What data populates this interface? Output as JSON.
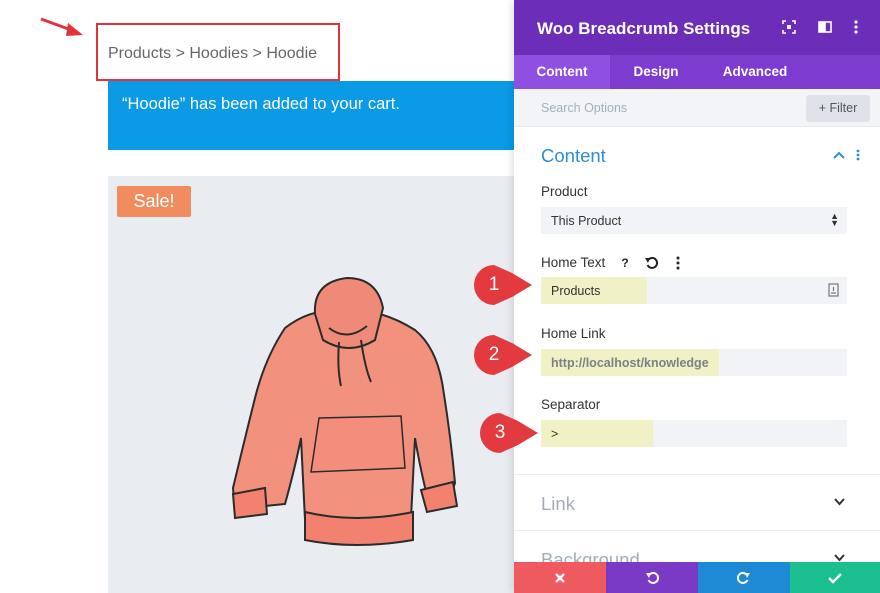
{
  "preview": {
    "breadcrumb": "Products > Hoodies > Hoodie",
    "notice": "“Hoodie” has been added to your cart.",
    "sale_badge": "Sale!"
  },
  "panel": {
    "title": "Woo Breadcrumb Settings",
    "header_icons": [
      "focus-icon",
      "columns-icon",
      "more-vertical-icon"
    ],
    "tabs": [
      {
        "label": "Content",
        "active": true
      },
      {
        "label": "Design",
        "active": false
      },
      {
        "label": "Advanced",
        "active": false
      }
    ],
    "search_placeholder": "Search Options",
    "filter_label": "+ Filter",
    "section_title": "Content",
    "product": {
      "label": "Product",
      "value": "This Product"
    },
    "home_text": {
      "label": "Home Text",
      "value": "Products"
    },
    "home_link": {
      "label": "Home Link",
      "value": "http://localhost/knowledge"
    },
    "separator": {
      "label": "Separator",
      "value": ">"
    },
    "collapsed_sections": [
      "Link",
      "Background"
    ],
    "footer": {
      "cancel_color": "#ee5a5f",
      "undo_color": "#7b3ac6",
      "redo_color": "#1e8ad6",
      "save_color": "#1cbf8f"
    }
  },
  "callouts": [
    "1",
    "2",
    "3"
  ],
  "colors": {
    "header_purple": "#6c2eb9",
    "tabs_purple": "#7e3bd0",
    "notice_blue": "#0a9ae6",
    "accent_blue": "#2c8fd6",
    "callout_red": "#e23a3f",
    "highlight_yellow": "#f0f1c4"
  }
}
